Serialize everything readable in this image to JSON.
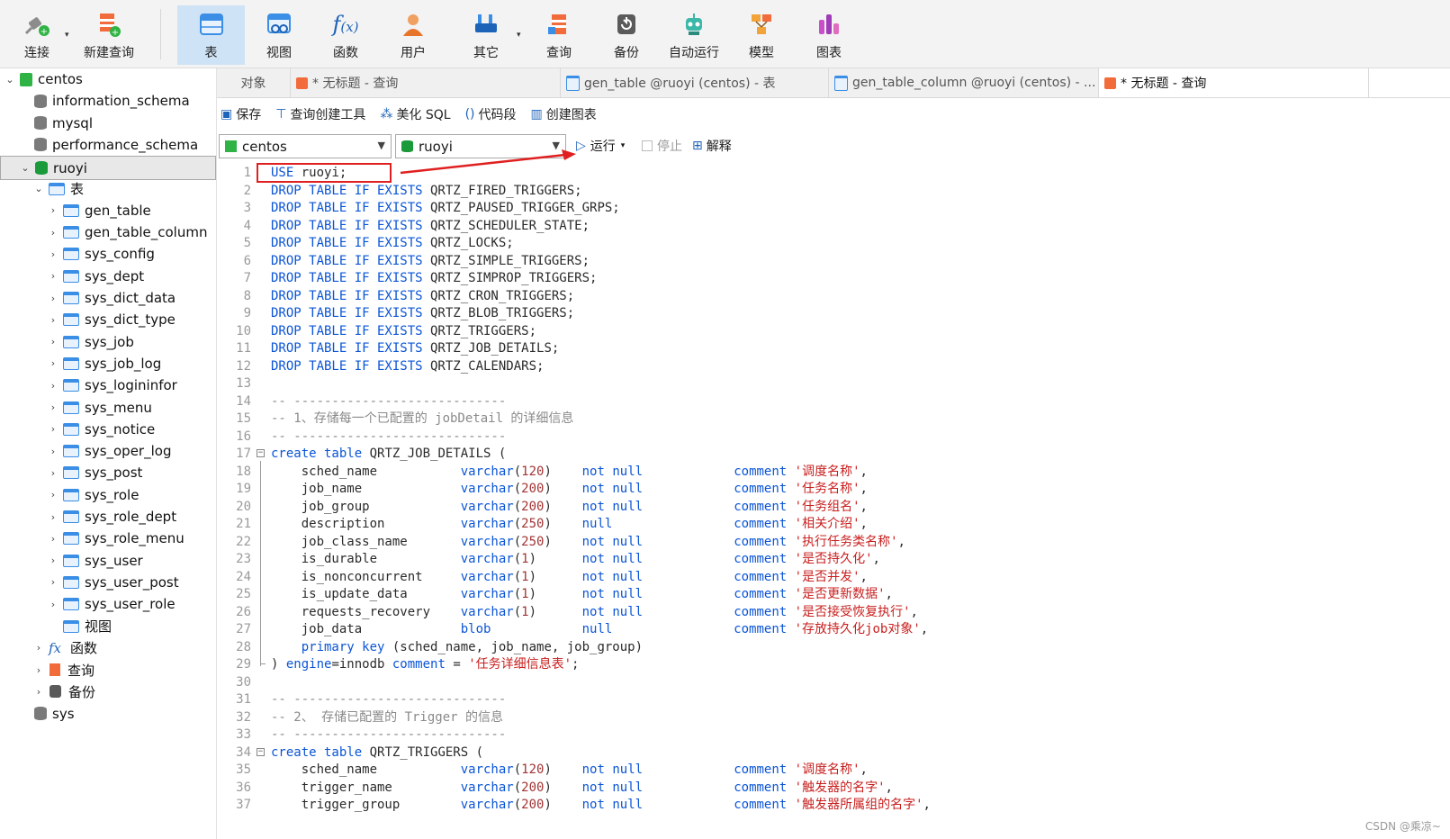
{
  "toolbar": {
    "connect": "连接",
    "new_query": "新建查询",
    "table": "表",
    "view": "视图",
    "function": "函数",
    "user": "用户",
    "other": "其它",
    "query": "查询",
    "backup": "备份",
    "automation": "自动运行",
    "model": "模型",
    "chart": "图表"
  },
  "sidebar": {
    "connection": "centos",
    "databases": [
      "information_schema",
      "mysql",
      "performance_schema"
    ],
    "active_db": "ruoyi",
    "tables_group": "表",
    "tables": [
      "gen_table",
      "gen_table_column",
      "sys_config",
      "sys_dept",
      "sys_dict_data",
      "sys_dict_type",
      "sys_job",
      "sys_job_log",
      "sys_logininfor",
      "sys_menu",
      "sys_notice",
      "sys_oper_log",
      "sys_post",
      "sys_role",
      "sys_role_dept",
      "sys_role_menu",
      "sys_user",
      "sys_user_post",
      "sys_user_role"
    ],
    "views_group": "视图",
    "functions_group": "函数",
    "queries_group": "查询",
    "backups_group": "备份",
    "other_db": "sys"
  },
  "tabs": {
    "objects": "对象",
    "tab1": "* 无标题 - 查询",
    "tab2": "gen_table @ruoyi (centos) - 表",
    "tab3": "gen_table_column @ruoyi (centos) - ...",
    "tab4": "* 无标题 - 查询"
  },
  "query_toolbar": {
    "save": "保存",
    "query_builder": "查询创建工具",
    "beautify": "美化 SQL",
    "snippet": "代码段",
    "create_chart": "创建图表"
  },
  "selectors": {
    "connection": "centos",
    "database": "ruoyi",
    "run": "运行",
    "stop": "停止",
    "explain": "解释"
  },
  "watermark": "CSDN @乘凉~",
  "colors": {
    "keyword": "#0b55d6",
    "string": "#c8201f",
    "comment": "#8a8a8a",
    "annotation": "#e02020",
    "active_tab": "#cfe3f7"
  },
  "code_lines": [
    {
      "n": "1",
      "t": [
        [
          "kw",
          "USE"
        ],
        [
          "nm",
          " ruoyi;"
        ]
      ]
    },
    {
      "n": "2",
      "t": [
        [
          "kw",
          "DROP TABLE IF EXISTS"
        ],
        [
          "nm",
          " QRTZ_FIRED_TRIGGERS;"
        ]
      ]
    },
    {
      "n": "3",
      "t": [
        [
          "kw",
          "DROP TABLE IF EXISTS"
        ],
        [
          "nm",
          " QRTZ_PAUSED_TRIGGER_GRPS;"
        ]
      ]
    },
    {
      "n": "4",
      "t": [
        [
          "kw",
          "DROP TABLE IF EXISTS"
        ],
        [
          "nm",
          " QRTZ_SCHEDULER_STATE;"
        ]
      ]
    },
    {
      "n": "5",
      "t": [
        [
          "kw",
          "DROP TABLE IF EXISTS"
        ],
        [
          "nm",
          " QRTZ_LOCKS;"
        ]
      ]
    },
    {
      "n": "6",
      "t": [
        [
          "kw",
          "DROP TABLE IF EXISTS"
        ],
        [
          "nm",
          " QRTZ_SIMPLE_TRIGGERS;"
        ]
      ]
    },
    {
      "n": "7",
      "t": [
        [
          "kw",
          "DROP TABLE IF EXISTS"
        ],
        [
          "nm",
          " QRTZ_SIMPROP_TRIGGERS;"
        ]
      ]
    },
    {
      "n": "8",
      "t": [
        [
          "kw",
          "DROP TABLE IF EXISTS"
        ],
        [
          "nm",
          " QRTZ_CRON_TRIGGERS;"
        ]
      ]
    },
    {
      "n": "9",
      "t": [
        [
          "kw",
          "DROP TABLE IF EXISTS"
        ],
        [
          "nm",
          " QRTZ_BLOB_TRIGGERS;"
        ]
      ]
    },
    {
      "n": "10",
      "t": [
        [
          "kw",
          "DROP TABLE IF EXISTS"
        ],
        [
          "nm",
          " QRTZ_TRIGGERS;"
        ]
      ]
    },
    {
      "n": "11",
      "t": [
        [
          "kw",
          "DROP TABLE IF EXISTS"
        ],
        [
          "nm",
          " QRTZ_JOB_DETAILS;"
        ]
      ]
    },
    {
      "n": "12",
      "t": [
        [
          "kw",
          "DROP TABLE IF EXISTS"
        ],
        [
          "nm",
          " QRTZ_CALENDARS;"
        ]
      ]
    },
    {
      "n": "13",
      "t": []
    },
    {
      "n": "14",
      "t": [
        [
          "cm",
          "-- ----------------------------"
        ]
      ]
    },
    {
      "n": "15",
      "t": [
        [
          "cm",
          "-- 1、存储每一个已配置的 jobDetail 的详细信息"
        ]
      ]
    },
    {
      "n": "16",
      "t": [
        [
          "cm",
          "-- ----------------------------"
        ]
      ]
    },
    {
      "n": "17",
      "fold": "start",
      "t": [
        [
          "kw",
          "create table"
        ],
        [
          "nm",
          " QRTZ_JOB_DETAILS ("
        ]
      ]
    },
    {
      "n": "18",
      "t": [
        [
          "nm",
          "    sched_name           "
        ],
        [
          "kw",
          "varchar"
        ],
        [
          "nm",
          "("
        ],
        [
          "num",
          "120"
        ],
        [
          "nm",
          ")    "
        ],
        [
          "kw",
          "not null"
        ],
        [
          "nm",
          "            "
        ],
        [
          "kw",
          "comment"
        ],
        [
          "nm",
          " "
        ],
        [
          "str",
          "'调度名称'"
        ],
        [
          "nm",
          ","
        ]
      ]
    },
    {
      "n": "19",
      "t": [
        [
          "nm",
          "    job_name             "
        ],
        [
          "kw",
          "varchar"
        ],
        [
          "nm",
          "("
        ],
        [
          "num",
          "200"
        ],
        [
          "nm",
          ")    "
        ],
        [
          "kw",
          "not null"
        ],
        [
          "nm",
          "            "
        ],
        [
          "kw",
          "comment"
        ],
        [
          "nm",
          " "
        ],
        [
          "str",
          "'任务名称'"
        ],
        [
          "nm",
          ","
        ]
      ]
    },
    {
      "n": "20",
      "t": [
        [
          "nm",
          "    job_group            "
        ],
        [
          "kw",
          "varchar"
        ],
        [
          "nm",
          "("
        ],
        [
          "num",
          "200"
        ],
        [
          "nm",
          ")    "
        ],
        [
          "kw",
          "not null"
        ],
        [
          "nm",
          "            "
        ],
        [
          "kw",
          "comment"
        ],
        [
          "nm",
          " "
        ],
        [
          "str",
          "'任务组名'"
        ],
        [
          "nm",
          ","
        ]
      ]
    },
    {
      "n": "21",
      "t": [
        [
          "nm",
          "    description          "
        ],
        [
          "kw",
          "varchar"
        ],
        [
          "nm",
          "("
        ],
        [
          "num",
          "250"
        ],
        [
          "nm",
          ")    "
        ],
        [
          "kw",
          "null"
        ],
        [
          "nm",
          "                "
        ],
        [
          "kw",
          "comment"
        ],
        [
          "nm",
          " "
        ],
        [
          "str",
          "'相关介绍'"
        ],
        [
          "nm",
          ","
        ]
      ]
    },
    {
      "n": "22",
      "t": [
        [
          "nm",
          "    job_class_name       "
        ],
        [
          "kw",
          "varchar"
        ],
        [
          "nm",
          "("
        ],
        [
          "num",
          "250"
        ],
        [
          "nm",
          ")    "
        ],
        [
          "kw",
          "not null"
        ],
        [
          "nm",
          "            "
        ],
        [
          "kw",
          "comment"
        ],
        [
          "nm",
          " "
        ],
        [
          "str",
          "'执行任务类名称'"
        ],
        [
          "nm",
          ","
        ]
      ]
    },
    {
      "n": "23",
      "t": [
        [
          "nm",
          "    is_durable           "
        ],
        [
          "kw",
          "varchar"
        ],
        [
          "nm",
          "("
        ],
        [
          "num",
          "1"
        ],
        [
          "nm",
          ")      "
        ],
        [
          "kw",
          "not null"
        ],
        [
          "nm",
          "            "
        ],
        [
          "kw",
          "comment"
        ],
        [
          "nm",
          " "
        ],
        [
          "str",
          "'是否持久化'"
        ],
        [
          "nm",
          ","
        ]
      ]
    },
    {
      "n": "24",
      "t": [
        [
          "nm",
          "    is_nonconcurrent     "
        ],
        [
          "kw",
          "varchar"
        ],
        [
          "nm",
          "("
        ],
        [
          "num",
          "1"
        ],
        [
          "nm",
          ")      "
        ],
        [
          "kw",
          "not null"
        ],
        [
          "nm",
          "            "
        ],
        [
          "kw",
          "comment"
        ],
        [
          "nm",
          " "
        ],
        [
          "str",
          "'是否并发'"
        ],
        [
          "nm",
          ","
        ]
      ]
    },
    {
      "n": "25",
      "t": [
        [
          "nm",
          "    is_update_data       "
        ],
        [
          "kw",
          "varchar"
        ],
        [
          "nm",
          "("
        ],
        [
          "num",
          "1"
        ],
        [
          "nm",
          ")      "
        ],
        [
          "kw",
          "not null"
        ],
        [
          "nm",
          "            "
        ],
        [
          "kw",
          "comment"
        ],
        [
          "nm",
          " "
        ],
        [
          "str",
          "'是否更新数据'"
        ],
        [
          "nm",
          ","
        ]
      ]
    },
    {
      "n": "26",
      "t": [
        [
          "nm",
          "    requests_recovery    "
        ],
        [
          "kw",
          "varchar"
        ],
        [
          "nm",
          "("
        ],
        [
          "num",
          "1"
        ],
        [
          "nm",
          ")      "
        ],
        [
          "kw",
          "not null"
        ],
        [
          "nm",
          "            "
        ],
        [
          "kw",
          "comment"
        ],
        [
          "nm",
          " "
        ],
        [
          "str",
          "'是否接受恢复执行'"
        ],
        [
          "nm",
          ","
        ]
      ]
    },
    {
      "n": "27",
      "t": [
        [
          "nm",
          "    job_data             "
        ],
        [
          "kw",
          "blob"
        ],
        [
          "nm",
          "            "
        ],
        [
          "kw",
          "null"
        ],
        [
          "nm",
          "                "
        ],
        [
          "kw",
          "comment"
        ],
        [
          "nm",
          " "
        ],
        [
          "str",
          "'存放持久化job对象'"
        ],
        [
          "nm",
          ","
        ]
      ]
    },
    {
      "n": "28",
      "t": [
        [
          "nm",
          "    "
        ],
        [
          "kw",
          "primary key"
        ],
        [
          "nm",
          " (sched_name, job_name, job_group)"
        ]
      ]
    },
    {
      "n": "29",
      "fold": "end",
      "t": [
        [
          "nm",
          ") "
        ],
        [
          "kw",
          "engine"
        ],
        [
          "nm",
          "=innodb "
        ],
        [
          "kw",
          "comment"
        ],
        [
          "nm",
          " = "
        ],
        [
          "str",
          "'任务详细信息表'"
        ],
        [
          "nm",
          ";"
        ]
      ]
    },
    {
      "n": "30",
      "t": []
    },
    {
      "n": "31",
      "t": [
        [
          "cm",
          "-- ----------------------------"
        ]
      ]
    },
    {
      "n": "32",
      "t": [
        [
          "cm",
          "-- 2、 存储已配置的 Trigger 的信息"
        ]
      ]
    },
    {
      "n": "33",
      "t": [
        [
          "cm",
          "-- ----------------------------"
        ]
      ]
    },
    {
      "n": "34",
      "fold": "start",
      "t": [
        [
          "kw",
          "create table"
        ],
        [
          "nm",
          " QRTZ_TRIGGERS ("
        ]
      ]
    },
    {
      "n": "35",
      "t": [
        [
          "nm",
          "    sched_name           "
        ],
        [
          "kw",
          "varchar"
        ],
        [
          "nm",
          "("
        ],
        [
          "num",
          "120"
        ],
        [
          "nm",
          ")    "
        ],
        [
          "kw",
          "not null"
        ],
        [
          "nm",
          "            "
        ],
        [
          "kw",
          "comment"
        ],
        [
          "nm",
          " "
        ],
        [
          "str",
          "'调度名称'"
        ],
        [
          "nm",
          ","
        ]
      ]
    },
    {
      "n": "36",
      "t": [
        [
          "nm",
          "    trigger_name         "
        ],
        [
          "kw",
          "varchar"
        ],
        [
          "nm",
          "("
        ],
        [
          "num",
          "200"
        ],
        [
          "nm",
          ")    "
        ],
        [
          "kw",
          "not null"
        ],
        [
          "nm",
          "            "
        ],
        [
          "kw",
          "comment"
        ],
        [
          "nm",
          " "
        ],
        [
          "str",
          "'触发器的名字'"
        ],
        [
          "nm",
          ","
        ]
      ]
    },
    {
      "n": "37",
      "t": [
        [
          "nm",
          "    trigger_group        "
        ],
        [
          "kw",
          "varchar"
        ],
        [
          "nm",
          "("
        ],
        [
          "num",
          "200"
        ],
        [
          "nm",
          ")    "
        ],
        [
          "kw",
          "not null"
        ],
        [
          "nm",
          "            "
        ],
        [
          "kw",
          "comment"
        ],
        [
          "nm",
          " "
        ],
        [
          "str",
          "'触发器所属组的名字'"
        ],
        [
          "nm",
          ","
        ]
      ]
    }
  ]
}
